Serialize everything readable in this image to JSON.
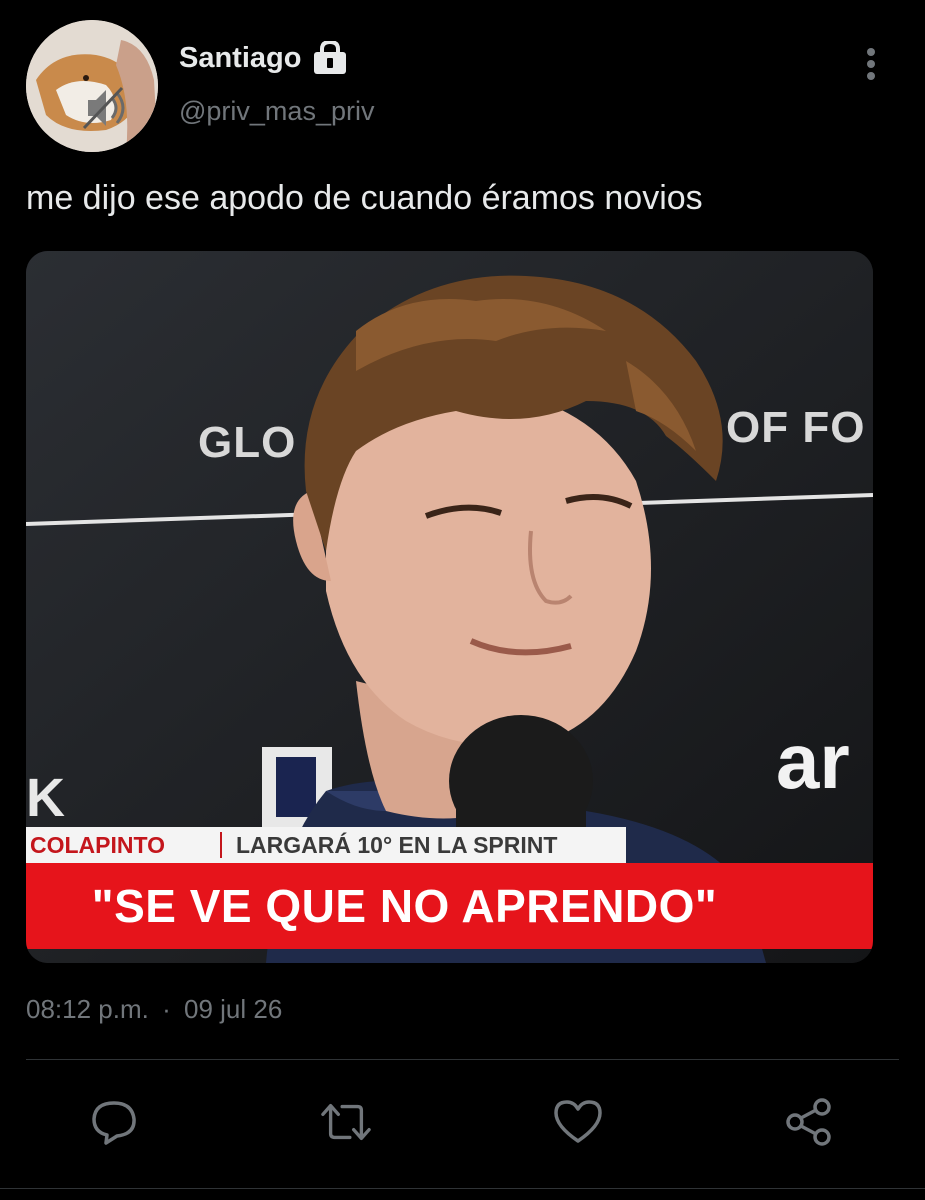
{
  "user": {
    "display_name": "Santiago",
    "handle": "@priv_mas_priv",
    "verified_lock": "lock-icon",
    "avatar": "avatar-photo"
  },
  "tweet": {
    "text": "me dijo ese apodo de cuando éramos novios",
    "time": "08:12 p.m.",
    "separator": "·",
    "date": "09 jul 26"
  },
  "media": {
    "background_text_left": "GLO",
    "background_text_right": "OF FO",
    "background_logo": "ar",
    "background_letter": "K",
    "lower_third": {
      "name": "COLAPINTO",
      "subtitle": "LARGARÁ 10° EN LA SPRINT",
      "headline": "\"SE VE QUE NO APRENDO\""
    }
  },
  "actions": [
    {
      "name": "reply",
      "icon": "reply-icon"
    },
    {
      "name": "retweet",
      "icon": "retweet-icon"
    },
    {
      "name": "like",
      "icon": "heart-icon"
    },
    {
      "name": "share",
      "icon": "share-icon"
    }
  ],
  "colors": {
    "background": "#000000",
    "text_primary": "#e7e9ea",
    "text_secondary": "#71767b",
    "lower_third_red": "#e6141b",
    "divider": "#2f3336"
  }
}
